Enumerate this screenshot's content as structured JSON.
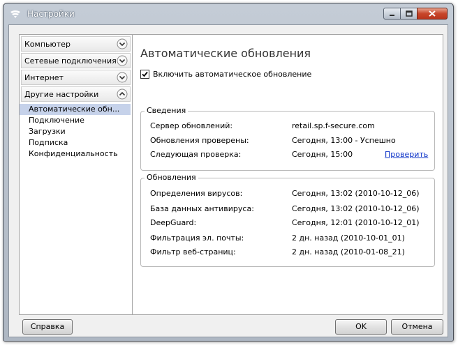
{
  "window": {
    "title": "Настройки"
  },
  "sidebar": {
    "sections": [
      {
        "label": "Компьютер",
        "state": "collapsed"
      },
      {
        "label": "Сетевые подключения",
        "state": "collapsed"
      },
      {
        "label": "Интернет",
        "state": "collapsed"
      },
      {
        "label": "Другие настройки",
        "state": "expanded"
      }
    ],
    "subitems": [
      "Автоматические обн...",
      "Подключение",
      "Загрузки",
      "Подписка",
      "Конфиденциальность"
    ],
    "selected_subitem": "Автоматические обн..."
  },
  "main": {
    "title": "Автоматические обновления",
    "auto_update_checkbox": {
      "label": "Включить автоматическое обновление",
      "checked": true
    },
    "info_group": {
      "title": "Сведения",
      "rows": [
        {
          "label": "Сервер обновлений:",
          "value": "retail.sp.f-secure.com"
        },
        {
          "label": "Обновления проверены:",
          "value": "Сегодня, 13:00 - Успешно"
        },
        {
          "label": "Следующая проверка:",
          "value": "Сегодня, 15:00"
        }
      ],
      "check_link": "Проверить"
    },
    "updates_group": {
      "title": "Обновления",
      "rows": [
        {
          "label": "Определения вирусов:",
          "value": "Сегодня, 13:02 (2010-10-12_06)"
        },
        {
          "label": "База данных антивируса:",
          "value": "Сегодня, 13:02 (2010-10-12_06)"
        },
        {
          "label": "DeepGuard:",
          "value": "Сегодня, 12:01 (2010-10-12_01)"
        },
        {
          "label": "Фильтрация эл. почты:",
          "value": "2 дн. назад (2010-10-01_01)"
        },
        {
          "label": "Фильтр веб-страниц:",
          "value": "2 дн. назад (2010-01-08_21)"
        }
      ]
    }
  },
  "footer": {
    "help": "Справка",
    "ok": "OK",
    "cancel": "Отмена"
  },
  "colors": {
    "selection": "#c6d2ea",
    "link": "#0b32c8",
    "close_button": "#c8462a"
  }
}
